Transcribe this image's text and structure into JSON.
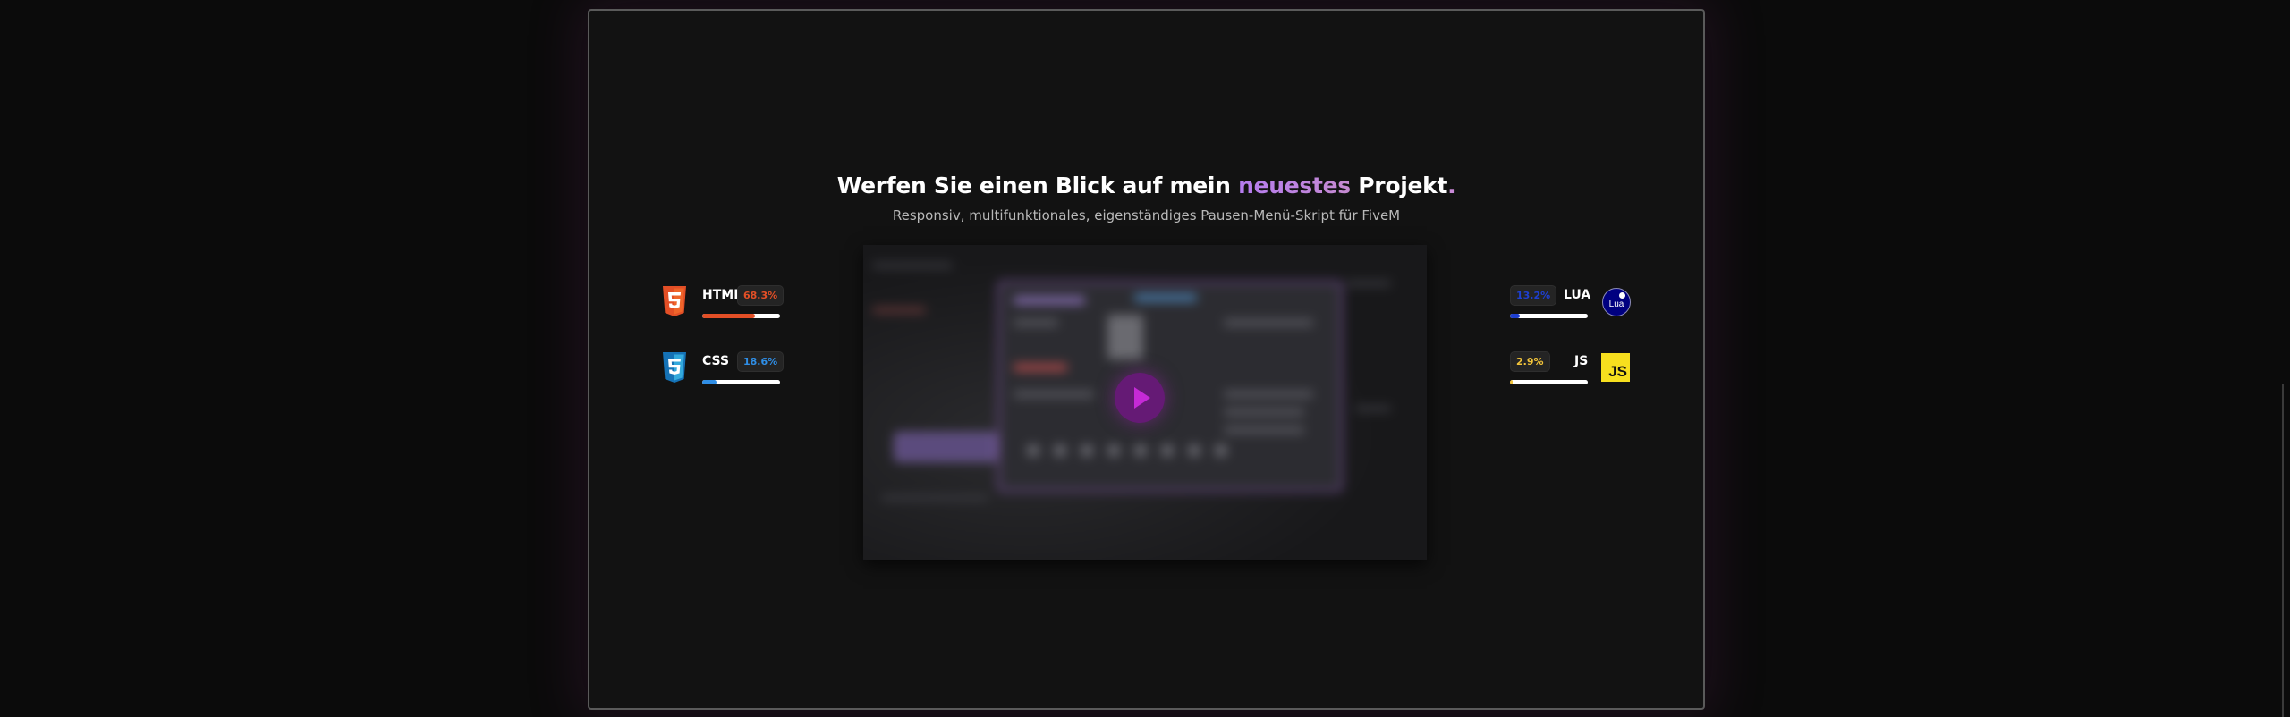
{
  "section": {
    "heading_part1": "Werfen Sie einen Blick auf mein",
    "heading_accent": "neuestes",
    "heading_part2": "Projekt",
    "heading_dot": ".",
    "subheading": "Responsiv, multifunktionales, eigenständiges Pausen-Menü-Skript für FiveM"
  },
  "video": {
    "play_icon": "play-icon"
  },
  "skills": [
    {
      "label": "HTML",
      "percent_text": "68.3%",
      "percent": 68.3,
      "color": "#e34f26",
      "icon": "html5-icon"
    },
    {
      "label": "CSS",
      "percent_text": "18.6%",
      "percent": 18.6,
      "color": "#2f8ee6",
      "icon": "css3-icon"
    },
    {
      "label": "LUA",
      "percent_text": "13.2%",
      "percent": 13.2,
      "color": "#1e3fd0",
      "icon": "lua-icon",
      "icon_text": "Lua"
    },
    {
      "label": "JS",
      "percent_text": "2.9%",
      "percent": 2.9,
      "color": "#f2c43a",
      "icon": "js-icon",
      "icon_text": "JS"
    }
  ],
  "colors": {
    "accent": "#b57cf0",
    "background": "#0b0b0b",
    "frame_border": "#5a5a5a"
  }
}
